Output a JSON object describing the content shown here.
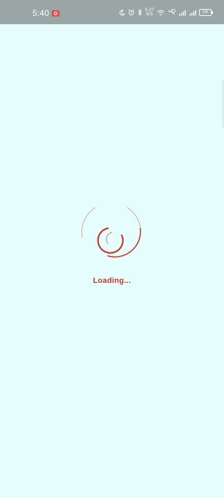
{
  "status_bar": {
    "time": "5:40",
    "network_speed_value": "0.27",
    "network_speed_unit": "K/S",
    "battery_level": "56",
    "icons": [
      "screen-record-icon",
      "moon-icon",
      "alarm-icon",
      "bluetooth-icon",
      "wifi-icon",
      "volte-icon",
      "signal-icon",
      "signal-icon",
      "battery-icon"
    ]
  },
  "main": {
    "loading_text": "Loading...",
    "accent_color": "#c0392b",
    "background_color": "#e6fdfd"
  }
}
